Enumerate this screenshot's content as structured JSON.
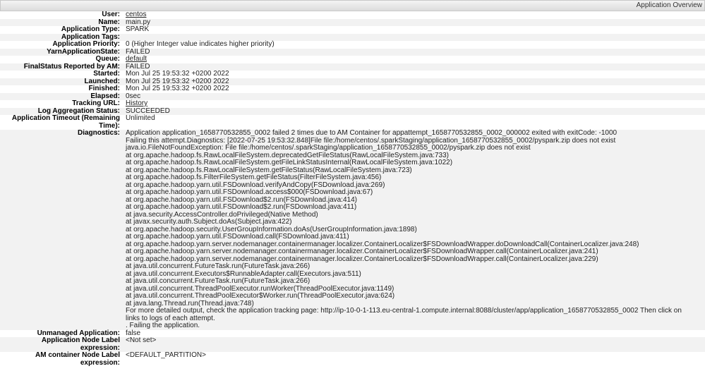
{
  "header": {
    "title": "Application Overview"
  },
  "rows": [
    {
      "key": "User:",
      "value": "centos",
      "link": true
    },
    {
      "key": "Name:",
      "value": "main.py"
    },
    {
      "key": "Application Type:",
      "value": "SPARK"
    },
    {
      "key": "Application Tags:",
      "value": ""
    },
    {
      "key": "Application Priority:",
      "value": "0 (Higher Integer value indicates higher priority)"
    },
    {
      "key": "YarnApplicationState:",
      "value": "FAILED"
    },
    {
      "key": "Queue:",
      "value": "default",
      "link": true
    },
    {
      "key": "FinalStatus Reported by AM:",
      "value": "FAILED"
    },
    {
      "key": "Started:",
      "value": "Mon Jul 25 19:53:32 +0200 2022"
    },
    {
      "key": "Launched:",
      "value": "Mon Jul 25 19:53:32 +0200 2022"
    },
    {
      "key": "Finished:",
      "value": "Mon Jul 25 19:53:32 +0200 2022"
    },
    {
      "key": "Elapsed:",
      "value": "0sec"
    },
    {
      "key": "Tracking URL:",
      "value": "History",
      "link": true
    },
    {
      "key": "Log Aggregation Status:",
      "value": "SUCCEEDED"
    },
    {
      "key": "Application Timeout (Remaining Time):",
      "value": "Unlimited"
    }
  ],
  "diagnostics": {
    "key": "Diagnostics:",
    "lines": [
      "Application application_1658770532855_0002 failed 2 times due to AM Container for appattempt_1658770532855_0002_000002 exited with exitCode: -1000",
      "Failing this attempt.Diagnostics: [2022-07-25 19:53:32.848]File file:/home/centos/.sparkStaging/application_1658770532855_0002/pyspark.zip does not exist",
      "java.io.FileNotFoundException: File file:/home/centos/.sparkStaging/application_1658770532855_0002/pyspark.zip does not exist",
      "at org.apache.hadoop.fs.RawLocalFileSystem.deprecatedGetFileStatus(RawLocalFileSystem.java:733)",
      "at org.apache.hadoop.fs.RawLocalFileSystem.getFileLinkStatusInternal(RawLocalFileSystem.java:1022)",
      "at org.apache.hadoop.fs.RawLocalFileSystem.getFileStatus(RawLocalFileSystem.java:723)",
      "at org.apache.hadoop.fs.FilterFileSystem.getFileStatus(FilterFileSystem.java:456)",
      "at org.apache.hadoop.yarn.util.FSDownload.verifyAndCopy(FSDownload.java:269)",
      "at org.apache.hadoop.yarn.util.FSDownload.access$000(FSDownload.java:67)",
      "at org.apache.hadoop.yarn.util.FSDownload$2.run(FSDownload.java:414)",
      "at org.apache.hadoop.yarn.util.FSDownload$2.run(FSDownload.java:411)",
      "at java.security.AccessController.doPrivileged(Native Method)",
      "at javax.security.auth.Subject.doAs(Subject.java:422)",
      "at org.apache.hadoop.security.UserGroupInformation.doAs(UserGroupInformation.java:1898)",
      "at org.apache.hadoop.yarn.util.FSDownload.call(FSDownload.java:411)",
      "at org.apache.hadoop.yarn.server.nodemanager.containermanager.localizer.ContainerLocalizer$FSDownloadWrapper.doDownloadCall(ContainerLocalizer.java:248)",
      "at org.apache.hadoop.yarn.server.nodemanager.containermanager.localizer.ContainerLocalizer$FSDownloadWrapper.call(ContainerLocalizer.java:241)",
      "at org.apache.hadoop.yarn.server.nodemanager.containermanager.localizer.ContainerLocalizer$FSDownloadWrapper.call(ContainerLocalizer.java:229)",
      "at java.util.concurrent.FutureTask.run(FutureTask.java:266)",
      "at java.util.concurrent.Executors$RunnableAdapter.call(Executors.java:511)",
      "at java.util.concurrent.FutureTask.run(FutureTask.java:266)",
      "at java.util.concurrent.ThreadPoolExecutor.runWorker(ThreadPoolExecutor.java:1149)",
      "at java.util.concurrent.ThreadPoolExecutor$Worker.run(ThreadPoolExecutor.java:624)",
      "at java.lang.Thread.run(Thread.java:748)",
      "For more detailed output, check the application tracking page: http://ip-10-0-1-113.eu-central-1.compute.internal:8088/cluster/app/application_1658770532855_0002 Then click on links to logs of each attempt.",
      ". Failing the application."
    ]
  },
  "footer_rows": [
    {
      "key": "Unmanaged Application:",
      "value": "false"
    },
    {
      "key": "Application Node Label expression:",
      "value": "<Not set>"
    },
    {
      "key": "AM container Node Label expression:",
      "value": "<DEFAULT_PARTITION>"
    }
  ]
}
